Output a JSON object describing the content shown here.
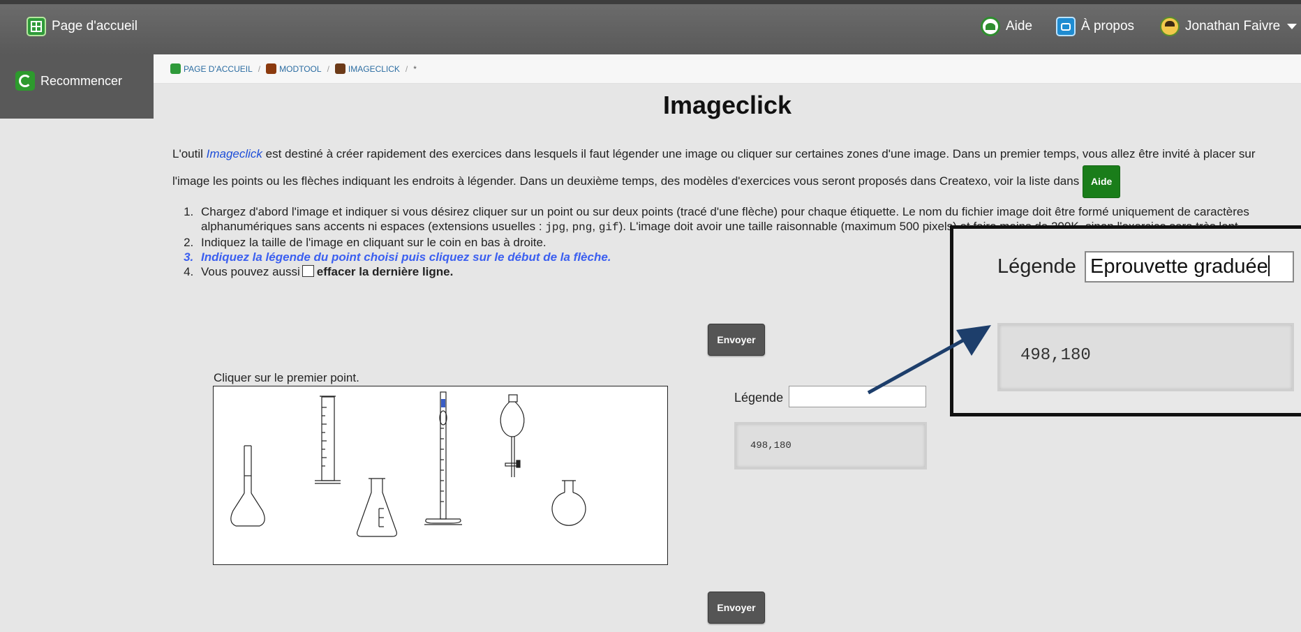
{
  "topbar": {
    "home_label": "Page d'accueil",
    "help_label": "Aide",
    "about_label": "À propos",
    "user_name": "Jonathan Faivre"
  },
  "sidebar": {
    "restart_label": "Recommencer"
  },
  "breadcrumb": {
    "items": [
      "PAGE D'ACCUEIL",
      "MODTOOL",
      "IMAGECLICK"
    ],
    "current": "*"
  },
  "main": {
    "title": "Imageclick",
    "intro_prefix": "L'outil ",
    "intro_tool": "Imageclick",
    "intro_text": " est destiné à créer rapidement des exercices dans lesquels il faut légender une image ou cliquer sur certaines zones d'une image. Dans un premier temps, vous allez être invité à placer sur l'image les points ou les flèches indiquant les endroits à légender. Dans un deuxième temps, des modèles d'exercices vous seront proposés dans Createxo, voir la liste dans ",
    "help_button": "Aide",
    "steps": {
      "s1_a": "Chargez d'abord l'image et indiquer si vous désirez cliquer sur un point ou sur deux points (tracé d'une flèche) pour chaque étiquette. Le nom du fichier image doit être formé uniquement de caractères alphanumériques sans accents ni espaces (extensions usuelles : ",
      "ext1": "jpg",
      "ext2": "png",
      "ext3": "gif",
      "s1_b": "). L'image doit avoir une taille raisonnable (maximum 500 pixels) et faire moins de 200K, sinon l'exercice sera très lent.",
      "s2": "Indiquez la taille de l'image en cliquant sur le coin en bas à droite.",
      "s3": "Indiquez la légende du point choisi puis cliquez sur le début de la flèche.",
      "s4_a": "Vous pouvez aussi",
      "s4_b": "effacer la dernière ligne."
    },
    "send_button": "Envoyer",
    "click_instruction": "Cliquer sur le premier point.",
    "legend_label": "Légende",
    "legend_value": "",
    "coords": "498,180"
  },
  "zoom": {
    "legend_label": "Légende",
    "legend_value": "Eprouvette graduée",
    "coords": "498,180"
  },
  "colors": {
    "topbar": "#5f5f5f",
    "sidebar": "#595959",
    "help_button": "#1a7d1a",
    "active_step": "#3b5ff0",
    "arrow": "#1d3e6b"
  },
  "icons": [
    "home-icon",
    "help-icon",
    "about-icon",
    "avatar-icon",
    "restart-icon"
  ]
}
